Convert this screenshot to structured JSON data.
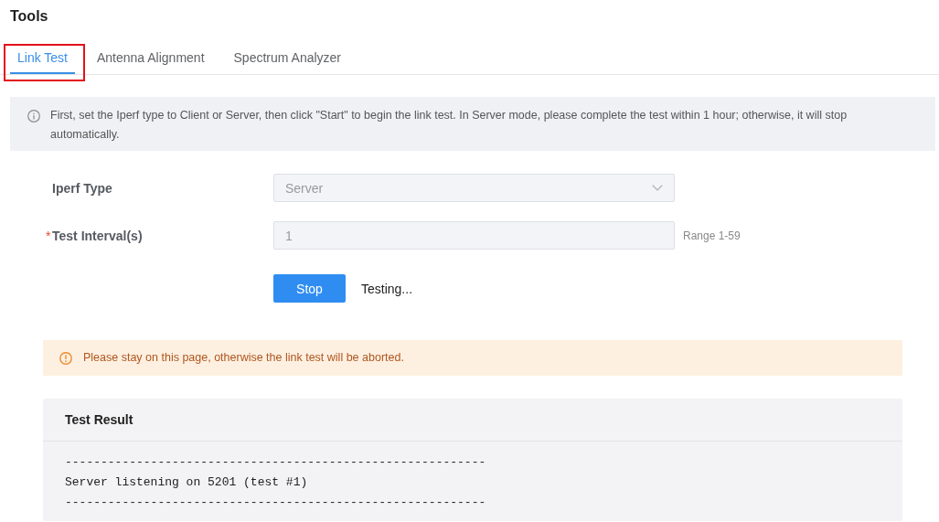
{
  "page": {
    "title": "Tools"
  },
  "tabs": [
    {
      "label": "Link Test",
      "selected": true,
      "highlighted": true
    },
    {
      "label": "Antenna Alignment",
      "selected": false,
      "highlighted": false
    },
    {
      "label": "Spectrum Analyzer",
      "selected": false,
      "highlighted": false
    }
  ],
  "info_notice": {
    "kind": "info",
    "text": "First, set the Iperf type to Client or Server, then click \"Start\" to begin the link test. In Server mode, please complete the test within 1 hour; otherwise, it will stop automatically."
  },
  "form": {
    "fields": [
      {
        "kind": "select",
        "label": "Iperf Type",
        "value": "Server",
        "disabled": true
      },
      {
        "kind": "input",
        "label": "Test Interval(s)",
        "required_mark": "*",
        "value": "1",
        "hint": "Range 1-59",
        "disabled": true
      }
    ]
  },
  "actions": {
    "button": "Stop",
    "status": "Testing..."
  },
  "warning_notice": {
    "kind": "warning",
    "text": "Please stay on this page, otherwise the link test will be aborted."
  },
  "result": {
    "title": "Test Result",
    "lines": [
      "-----------------------------------------------------------",
      "Server listening on 5201 (test #1)",
      "-----------------------------------------------------------"
    ]
  }
}
